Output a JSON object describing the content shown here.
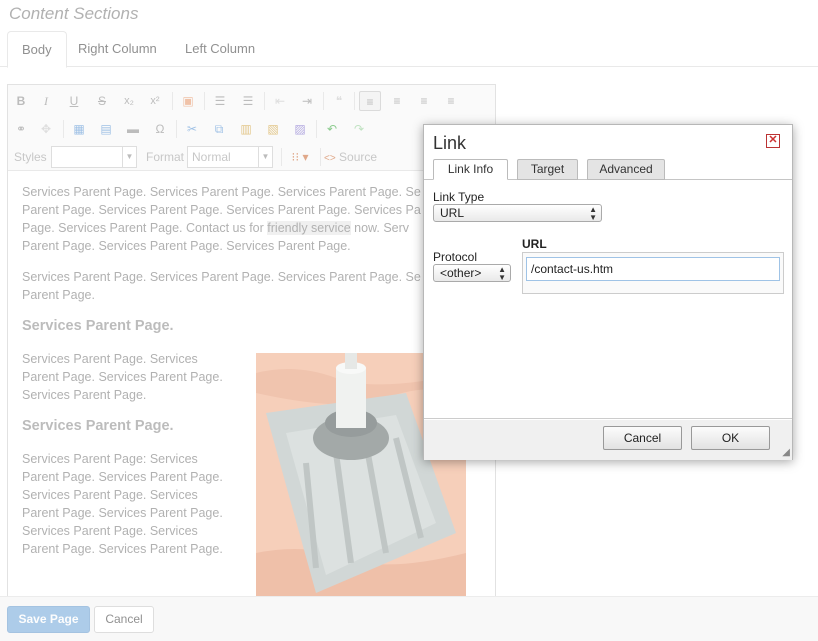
{
  "section_title": "Content Sections",
  "tabs": [
    {
      "label": "Body",
      "active": true
    },
    {
      "label": "Right Column",
      "active": false
    },
    {
      "label": "Left Column",
      "active": false
    }
  ],
  "toolbar": {
    "styles_label": "Styles",
    "styles_value": "",
    "format_label": "Format",
    "format_value": "Normal",
    "source_label": "Source"
  },
  "content": {
    "para1": [
      "Services Parent Page. Services Parent Page. Services Parent Page. Se",
      "Parent Page. Services Parent Page. Services Parent Page. Services Pa",
      "Page. Services Parent Page. Contact us for ",
      "friendly service",
      " now. Serv",
      "Parent Page. Services Parent Page. Services Parent Page."
    ],
    "para2": [
      "Services Parent Page. Services Parent Page. Services Parent Page. Se",
      "Parent Page."
    ],
    "heading1": "Services Parent Page.",
    "para3": "Services Parent Page. Services Parent Page. Services Parent Page. Services Parent Page.",
    "heading2": "Services Parent Page.",
    "para4": "Services Parent Page: Services Parent Page. Services Parent Page. Services Parent Page. Services Parent Page. Services Parent Page. Services Parent Page. Services Parent Page. Services Parent Page."
  },
  "footer": {
    "save_label": "Save Page",
    "cancel_label": "Cancel"
  },
  "dialog": {
    "title": "Link",
    "tabs": [
      {
        "label": "Link Info",
        "active": true
      },
      {
        "label": "Target",
        "active": false
      },
      {
        "label": "Advanced",
        "active": false
      }
    ],
    "link_type_label": "Link Type",
    "link_type_value": "URL",
    "protocol_label": "Protocol",
    "protocol_value": "<other>",
    "url_label": "URL",
    "url_value": "/contact-us.htm",
    "cancel_label": "Cancel",
    "ok_label": "OK"
  }
}
